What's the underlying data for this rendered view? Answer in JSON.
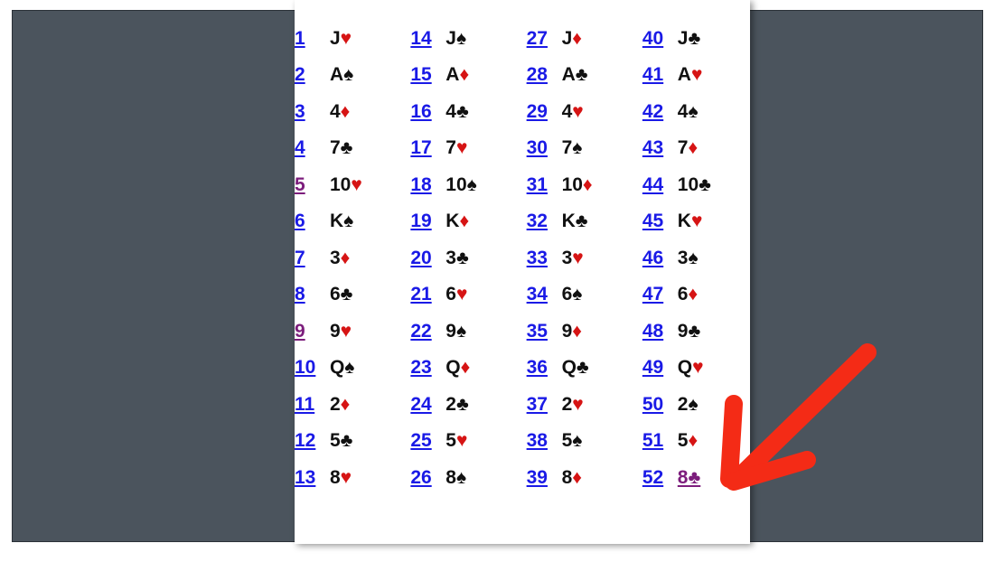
{
  "document": {
    "title": "Deck of cards numbered list",
    "page_background": "#ffffff",
    "backdrop_color": "#4b545d",
    "link_color": "#1a1ae6",
    "visited_link_color": "#7c1d7c",
    "red_suit_color": "#d61414",
    "black_suit_color": "#111111"
  },
  "annotation": {
    "type": "arrow",
    "color": "#f42b16",
    "points_to": "entry-52",
    "direction": "down-left"
  },
  "suits": {
    "hearts": "♥",
    "diamonds": "♦",
    "clubs": "♣",
    "spades": "♠"
  },
  "columns": [
    {
      "name": "column-1",
      "entries": [
        {
          "number": "1",
          "rank": "J",
          "suit": "♥",
          "suit_name": "hearts",
          "color": "red",
          "number_state": "link",
          "card_state": "plain"
        },
        {
          "number": "2",
          "rank": "A",
          "suit": "♠",
          "suit_name": "spades",
          "color": "black",
          "number_state": "link",
          "card_state": "plain"
        },
        {
          "number": "3",
          "rank": "4",
          "suit": "♦",
          "suit_name": "diamonds",
          "color": "red",
          "number_state": "link",
          "card_state": "plain"
        },
        {
          "number": "4",
          "rank": "7",
          "suit": "♣",
          "suit_name": "clubs",
          "color": "black",
          "number_state": "link",
          "card_state": "plain"
        },
        {
          "number": "5",
          "rank": "10",
          "suit": "♥",
          "suit_name": "hearts",
          "color": "red",
          "number_state": "visited",
          "card_state": "plain"
        },
        {
          "number": "6",
          "rank": "K",
          "suit": "♠",
          "suit_name": "spades",
          "color": "black",
          "number_state": "link",
          "card_state": "plain"
        },
        {
          "number": "7",
          "rank": "3",
          "suit": "♦",
          "suit_name": "diamonds",
          "color": "red",
          "number_state": "link",
          "card_state": "plain"
        },
        {
          "number": "8",
          "rank": "6",
          "suit": "♣",
          "suit_name": "clubs",
          "color": "black",
          "number_state": "link",
          "card_state": "plain"
        },
        {
          "number": "9",
          "rank": "9",
          "suit": "♥",
          "suit_name": "hearts",
          "color": "red",
          "number_state": "visited",
          "card_state": "plain"
        },
        {
          "number": "10",
          "rank": "Q",
          "suit": "♠",
          "suit_name": "spades",
          "color": "black",
          "number_state": "link",
          "card_state": "plain"
        },
        {
          "number": "11",
          "rank": "2",
          "suit": "♦",
          "suit_name": "diamonds",
          "color": "red",
          "number_state": "link",
          "card_state": "plain"
        },
        {
          "number": "12",
          "rank": "5",
          "suit": "♣",
          "suit_name": "clubs",
          "color": "black",
          "number_state": "link",
          "card_state": "plain"
        },
        {
          "number": "13",
          "rank": "8",
          "suit": "♥",
          "suit_name": "hearts",
          "color": "red",
          "number_state": "link",
          "card_state": "plain"
        }
      ]
    },
    {
      "name": "column-2",
      "entries": [
        {
          "number": "14",
          "rank": "J",
          "suit": "♠",
          "suit_name": "spades",
          "color": "black",
          "number_state": "link",
          "card_state": "plain"
        },
        {
          "number": "15",
          "rank": "A",
          "suit": "♦",
          "suit_name": "diamonds",
          "color": "red",
          "number_state": "link",
          "card_state": "plain"
        },
        {
          "number": "16",
          "rank": "4",
          "suit": "♣",
          "suit_name": "clubs",
          "color": "black",
          "number_state": "link",
          "card_state": "plain"
        },
        {
          "number": "17",
          "rank": "7",
          "suit": "♥",
          "suit_name": "hearts",
          "color": "red",
          "number_state": "link",
          "card_state": "plain"
        },
        {
          "number": "18",
          "rank": "10",
          "suit": "♠",
          "suit_name": "spades",
          "color": "black",
          "number_state": "link",
          "card_state": "plain"
        },
        {
          "number": "19",
          "rank": "K",
          "suit": "♦",
          "suit_name": "diamonds",
          "color": "red",
          "number_state": "link",
          "card_state": "plain"
        },
        {
          "number": "20",
          "rank": "3",
          "suit": "♣",
          "suit_name": "clubs",
          "color": "black",
          "number_state": "link",
          "card_state": "plain"
        },
        {
          "number": "21",
          "rank": "6",
          "suit": "♥",
          "suit_name": "hearts",
          "color": "red",
          "number_state": "link",
          "card_state": "plain"
        },
        {
          "number": "22",
          "rank": "9",
          "suit": "♠",
          "suit_name": "spades",
          "color": "black",
          "number_state": "link",
          "card_state": "plain"
        },
        {
          "number": "23",
          "rank": "Q",
          "suit": "♦",
          "suit_name": "diamonds",
          "color": "red",
          "number_state": "link",
          "card_state": "plain"
        },
        {
          "number": "24",
          "rank": "2",
          "suit": "♣",
          "suit_name": "clubs",
          "color": "black",
          "number_state": "link",
          "card_state": "plain"
        },
        {
          "number": "25",
          "rank": "5",
          "suit": "♥",
          "suit_name": "hearts",
          "color": "red",
          "number_state": "link",
          "card_state": "plain"
        },
        {
          "number": "26",
          "rank": "8",
          "suit": "♠",
          "suit_name": "spades",
          "color": "black",
          "number_state": "link",
          "card_state": "plain"
        }
      ]
    },
    {
      "name": "column-3",
      "entries": [
        {
          "number": "27",
          "rank": "J",
          "suit": "♦",
          "suit_name": "diamonds",
          "color": "red",
          "number_state": "link",
          "card_state": "plain"
        },
        {
          "number": "28",
          "rank": "A",
          "suit": "♣",
          "suit_name": "clubs",
          "color": "black",
          "number_state": "link",
          "card_state": "plain"
        },
        {
          "number": "29",
          "rank": "4",
          "suit": "♥",
          "suit_name": "hearts",
          "color": "red",
          "number_state": "link",
          "card_state": "plain"
        },
        {
          "number": "30",
          "rank": "7",
          "suit": "♠",
          "suit_name": "spades",
          "color": "black",
          "number_state": "link",
          "card_state": "plain"
        },
        {
          "number": "31",
          "rank": "10",
          "suit": "♦",
          "suit_name": "diamonds",
          "color": "red",
          "number_state": "link",
          "card_state": "plain"
        },
        {
          "number": "32",
          "rank": "K",
          "suit": "♣",
          "suit_name": "clubs",
          "color": "black",
          "number_state": "link",
          "card_state": "plain"
        },
        {
          "number": "33",
          "rank": "3",
          "suit": "♥",
          "suit_name": "hearts",
          "color": "red",
          "number_state": "link",
          "card_state": "plain"
        },
        {
          "number": "34",
          "rank": "6",
          "suit": "♠",
          "suit_name": "spades",
          "color": "black",
          "number_state": "link",
          "card_state": "plain"
        },
        {
          "number": "35",
          "rank": "9",
          "suit": "♦",
          "suit_name": "diamonds",
          "color": "red",
          "number_state": "link",
          "card_state": "plain"
        },
        {
          "number": "36",
          "rank": "Q",
          "suit": "♣",
          "suit_name": "clubs",
          "color": "black",
          "number_state": "link",
          "card_state": "plain"
        },
        {
          "number": "37",
          "rank": "2",
          "suit": "♥",
          "suit_name": "hearts",
          "color": "red",
          "number_state": "link",
          "card_state": "plain"
        },
        {
          "number": "38",
          "rank": "5",
          "suit": "♠",
          "suit_name": "spades",
          "color": "black",
          "number_state": "link",
          "card_state": "plain"
        },
        {
          "number": "39",
          "rank": "8",
          "suit": "♦",
          "suit_name": "diamonds",
          "color": "red",
          "number_state": "link",
          "card_state": "plain"
        }
      ]
    },
    {
      "name": "column-4",
      "entries": [
        {
          "number": "40",
          "rank": "J",
          "suit": "♣",
          "suit_name": "clubs",
          "color": "black",
          "number_state": "link",
          "card_state": "plain"
        },
        {
          "number": "41",
          "rank": "A",
          "suit": "♥",
          "suit_name": "hearts",
          "color": "red",
          "number_state": "link",
          "card_state": "plain"
        },
        {
          "number": "42",
          "rank": "4",
          "suit": "♠",
          "suit_name": "spades",
          "color": "black",
          "number_state": "link",
          "card_state": "plain"
        },
        {
          "number": "43",
          "rank": "7",
          "suit": "♦",
          "suit_name": "diamonds",
          "color": "red",
          "number_state": "link",
          "card_state": "plain"
        },
        {
          "number": "44",
          "rank": "10",
          "suit": "♣",
          "suit_name": "clubs",
          "color": "black",
          "number_state": "link",
          "card_state": "plain"
        },
        {
          "number": "45",
          "rank": "K",
          "suit": "♥",
          "suit_name": "hearts",
          "color": "red",
          "number_state": "link",
          "card_state": "plain"
        },
        {
          "number": "46",
          "rank": "3",
          "suit": "♠",
          "suit_name": "spades",
          "color": "black",
          "number_state": "link",
          "card_state": "plain"
        },
        {
          "number": "47",
          "rank": "6",
          "suit": "♦",
          "suit_name": "diamonds",
          "color": "red",
          "number_state": "link",
          "card_state": "plain"
        },
        {
          "number": "48",
          "rank": "9",
          "suit": "♣",
          "suit_name": "clubs",
          "color": "black",
          "number_state": "link",
          "card_state": "plain"
        },
        {
          "number": "49",
          "rank": "Q",
          "suit": "♥",
          "suit_name": "hearts",
          "color": "red",
          "number_state": "link",
          "card_state": "plain"
        },
        {
          "number": "50",
          "rank": "2",
          "suit": "♠",
          "suit_name": "spades",
          "color": "black",
          "number_state": "link",
          "card_state": "plain"
        },
        {
          "number": "51",
          "rank": "5",
          "suit": "♦",
          "suit_name": "diamonds",
          "color": "red",
          "number_state": "link",
          "card_state": "plain"
        },
        {
          "number": "52",
          "rank": "8",
          "suit": "♣",
          "suit_name": "clubs",
          "color": "black",
          "number_state": "link",
          "card_state": "visited"
        }
      ]
    }
  ]
}
